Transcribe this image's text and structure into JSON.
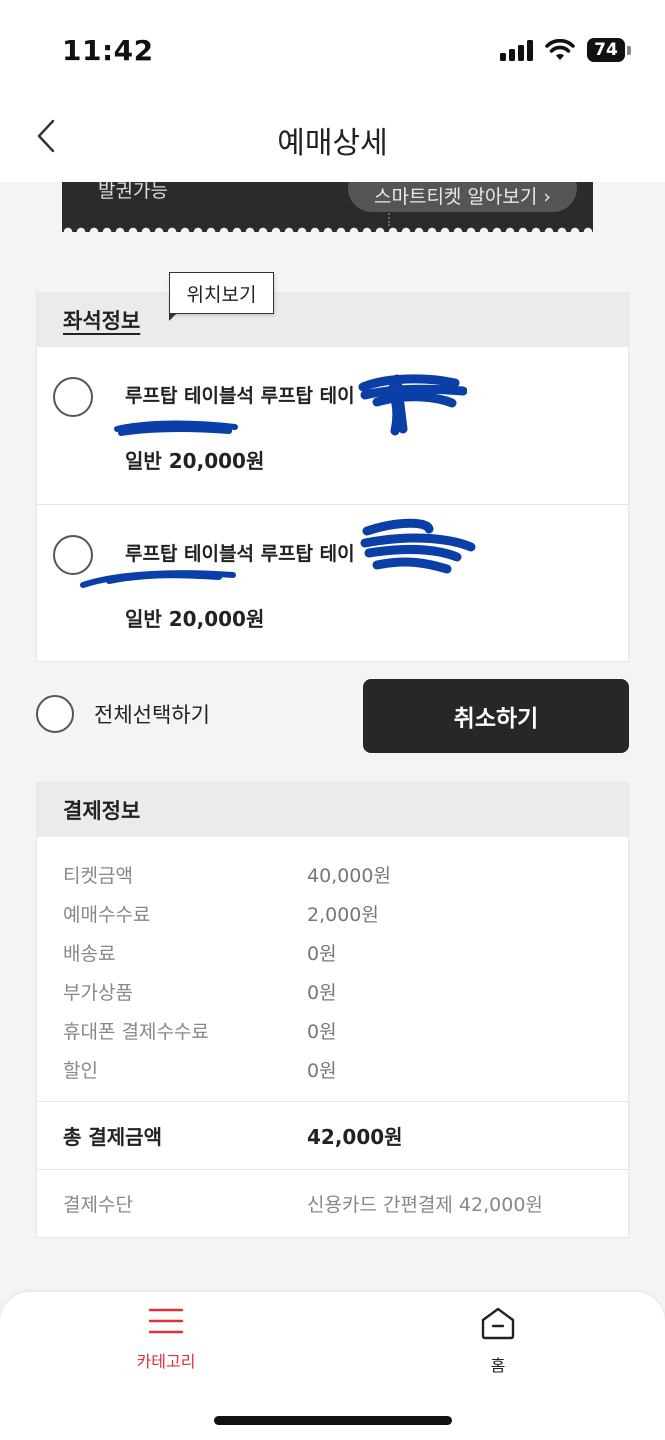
{
  "status_bar": {
    "time": "11:42",
    "battery": "74"
  },
  "nav": {
    "title": "예매상세"
  },
  "ticket": {
    "issue_label": "발권가능",
    "smart_ticket_button": "스마트티켓 알아보기 ›"
  },
  "tooltip": {
    "label": "위치보기"
  },
  "seat_info": {
    "title": "좌석정보",
    "seats": [
      {
        "name": "루프탑 테이블석 루프탑 테이",
        "price": "일반 20,000원"
      },
      {
        "name": "루프탑 테이블석 루프탑 테이",
        "price": "일반 20,000원"
      }
    ]
  },
  "actions": {
    "select_all": "전체선택하기",
    "cancel": "취소하기"
  },
  "payment": {
    "title": "결제정보",
    "rows": [
      {
        "label": "티켓금액",
        "value": "40,000원"
      },
      {
        "label": "예매수수료",
        "value": "2,000원"
      },
      {
        "label": "배송료",
        "value": "0원"
      },
      {
        "label": "부가상품",
        "value": "0원"
      },
      {
        "label": "휴대폰 결제수수료",
        "value": "0원"
      },
      {
        "label": "할인",
        "value": "0원"
      }
    ],
    "total": {
      "label": "총 결제금액",
      "value": "42,000원"
    },
    "method": {
      "label": "결제수단",
      "value": "신용카드 간편결제 42,000원"
    }
  },
  "tabbar": {
    "category": "카테고리",
    "home": "홈"
  },
  "colors": {
    "accent": "#e0303a",
    "button_dark": "#27272a",
    "scribble": "#0a3fa8"
  }
}
